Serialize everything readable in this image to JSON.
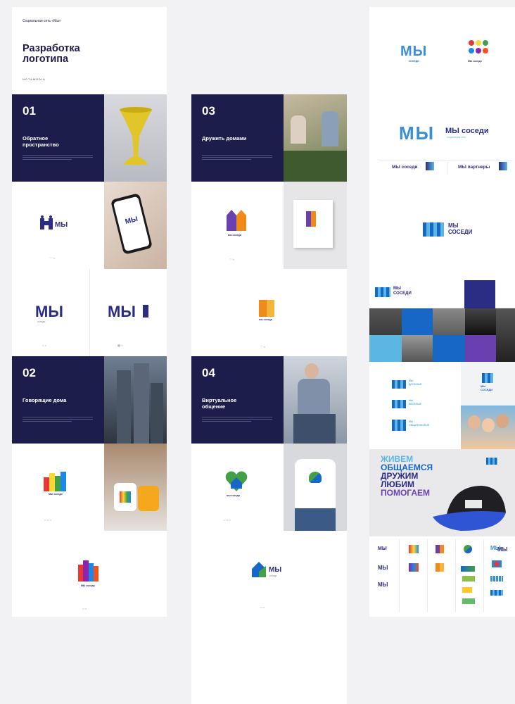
{
  "header": {
    "kicker": "Социальная сеть «Мы»",
    "title_line1": "Разработка",
    "title_line2": "логотипа",
    "brand": "NOTAMEDIA"
  },
  "sections": [
    {
      "num": "01",
      "title_line1": "Обратное",
      "title_line2": "пространство"
    },
    {
      "num": "02",
      "title_line1": "Говорящие дома",
      "title_line2": ""
    },
    {
      "num": "03",
      "title_line1": "Дружить домами",
      "title_line2": ""
    },
    {
      "num": "04",
      "title_line1": "Виртуальное",
      "title_line2": "общение"
    }
  ],
  "logos": {
    "my": "МЫ",
    "sosedi": "соседи",
    "sosedi_upper": "СОСЕДИ",
    "my_sosedi": "МЫ соседи",
    "my_sosedi_lower": "мы соседи",
    "my_partners": "МЫ партнеры",
    "social_sub": "социальная сеть",
    "druzhnye": "ДРУЖНЫЕ",
    "veselye": "ВЕСЁЛЫЕ",
    "obshchitelnye": "ОБЩИТЕЛЬНЫЕ"
  },
  "slogan": {
    "l1": "ЖИВЕМ",
    "l2": "ОБЩАЕМСЯ",
    "l3": "ДРУЖИМ",
    "l4": "ЛЮБИМ",
    "l5": "ПОМОГАЕМ"
  },
  "colors": {
    "navy": "#1c1d4a",
    "brand_blue": "#2b2d84",
    "accent_blue": "#1767c7",
    "light_blue": "#5bb6e4",
    "purple": "#6a3fb0",
    "orange": "#f08a1a"
  }
}
